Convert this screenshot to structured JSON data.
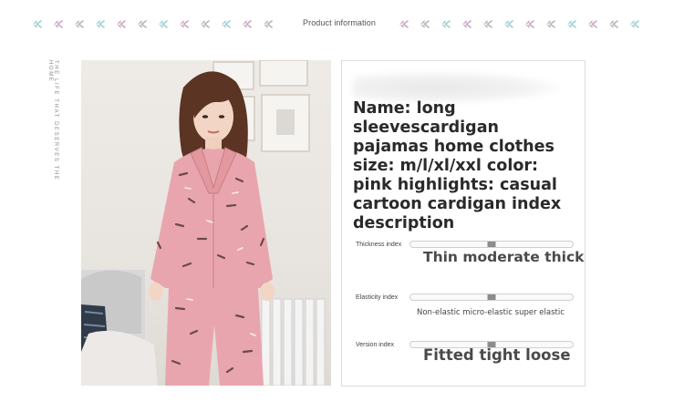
{
  "header": {
    "title": "Product information",
    "decor_icon": "leaf-sprig-icon",
    "decor_colors": [
      "#9ecfcf",
      "#c9a7c1",
      "#b5b5b5"
    ]
  },
  "side_text": "THE LIFE THAT DESERVES THE HOME",
  "product_photo": {
    "subject": "woman-in-pink-pajamas",
    "main_color": "#e9a5ad"
  },
  "info_panel": {
    "description": "Name: long sleevescardigan pajamas home clothes size: m/l/xl/xxl color: pink highlights: casual cartoon cardigan index description"
  },
  "indexes": [
    {
      "label": "Thickness index",
      "scale_text": "Thin moderate thick",
      "level_fraction": 0.5
    },
    {
      "label": "Elasticity index",
      "scale_text": "Non-elastic micro-elastic super elastic",
      "level_fraction": 0.5
    },
    {
      "label": "Version index",
      "scale_text": "Fitted tight loose",
      "level_fraction": 0.5
    }
  ]
}
